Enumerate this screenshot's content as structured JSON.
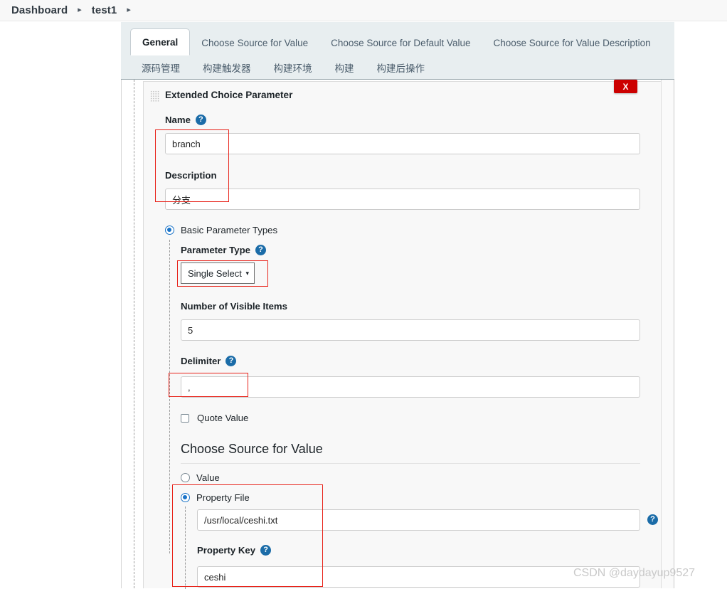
{
  "breadcrumb": {
    "items": [
      {
        "label": "Dashboard"
      },
      {
        "label": "test1"
      }
    ],
    "separator": "▸",
    "trailing_separator": "▸"
  },
  "tabs": {
    "primary": [
      {
        "label": "General",
        "active": true
      },
      {
        "label": "Choose Source for Value",
        "active": false
      },
      {
        "label": "Choose Source for Default Value",
        "active": false
      },
      {
        "label": "Choose Source for Value Description",
        "active": false
      }
    ],
    "secondary": [
      {
        "label": "源码管理"
      },
      {
        "label": "构建触发器"
      },
      {
        "label": "构建环境"
      },
      {
        "label": "构建"
      },
      {
        "label": "构建后操作"
      }
    ]
  },
  "block": {
    "title": "Extended Choice Parameter",
    "close_label": "X",
    "grip_icon": "drag-handle-icon"
  },
  "form": {
    "name_label": "Name",
    "name_help": "?",
    "name_value": "branch",
    "description_label": "Description",
    "description_value": "分支",
    "basic_parameter_types_label": "Basic Parameter Types",
    "basic_parameter_types_selected": true,
    "parameter_type_label": "Parameter Type",
    "parameter_type_help": "?",
    "parameter_type_value": "Single Select",
    "parameter_type_options": [
      "Single Select"
    ],
    "parameter_type_caret": "⌄",
    "visible_items_label": "Number of Visible Items",
    "visible_items_value": "5",
    "delimiter_label": "Delimiter",
    "delimiter_help": "?",
    "delimiter_value": ",",
    "quote_value_label": "Quote Value",
    "quote_value_checked": false
  },
  "source_section": {
    "heading": "Choose Source for Value",
    "value_radio_label": "Value",
    "value_radio_selected": false,
    "property_file_radio_label": "Property File",
    "property_file_radio_selected": true,
    "property_file_value": "/usr/local/ceshi.txt",
    "property_file_help": "?",
    "property_key_label": "Property Key",
    "property_key_help": "?",
    "property_key_value": "ceshi"
  },
  "watermark": {
    "text": "CSDN @daydayup9527"
  },
  "colors": {
    "accent_blue": "#1a73c8",
    "help_blue": "#1b6ca8",
    "annotation_red": "#e8231a",
    "close_red": "#cc0000",
    "tab_bg": "#e8eef0",
    "panel_bg": "#f8f8f8"
  }
}
